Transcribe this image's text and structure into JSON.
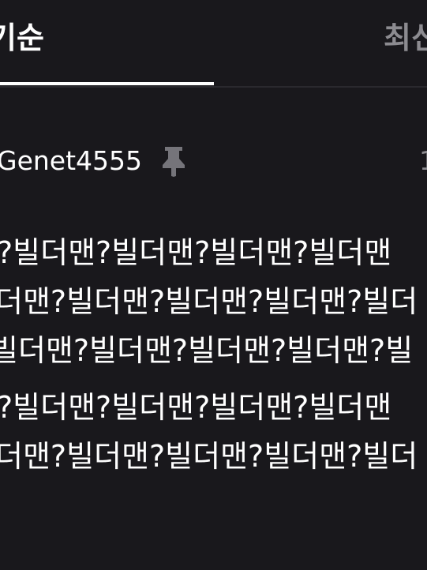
{
  "tabs": {
    "active_label": "기순",
    "inactive_label": "최신"
  },
  "comment": {
    "author": "Genet4555",
    "meta_count": "1",
    "lines": [
      "?빌더맨?빌더맨?빌더맨?빌더맨",
      "더맨?빌더맨?빌더맨?빌더맨?빌더",
      "빌더맨?빌더맨?빌더맨?빌더맨?빌",
      "?빌더맨?빌더맨?빌더맨?빌더맨",
      "더맨?빌더맨?빌더맨?빌더맨?빌더"
    ]
  },
  "icons": {
    "pin": "pin-icon"
  },
  "colors": {
    "background": "#19181c",
    "text_primary": "#ffffff",
    "text_secondary": "#8c8b90",
    "icon": "#75747a",
    "divider": "#2a292e"
  }
}
